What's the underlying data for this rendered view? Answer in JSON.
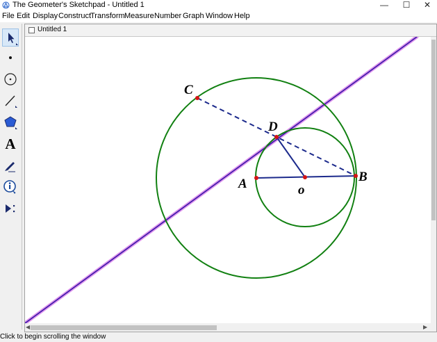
{
  "window": {
    "title": "The Geometer's Sketchpad - Untitled 1",
    "controls": {
      "minimize": "—",
      "maximize": "☐",
      "close": "✕"
    }
  },
  "menu": [
    "File",
    "Edit",
    "Display",
    "Construct",
    "Transform",
    "Measure",
    "Number",
    "Graph",
    "Window",
    "Help"
  ],
  "toolbox": {
    "tools": [
      "arrow-select-tool",
      "point-tool",
      "compass-tool",
      "straightedge-tool",
      "polygon-tool",
      "text-tool",
      "marker-tool",
      "information-tool",
      "custom-tools"
    ],
    "text_tool_glyph": "A"
  },
  "document": {
    "title": "Untitled 1"
  },
  "sketch": {
    "point_labels": {
      "A": "A",
      "B": "B",
      "C": "C",
      "D": "D",
      "O": "o"
    },
    "colors": {
      "circle": "#118011",
      "segment": "#1c2a8c",
      "dashed": "#1c2a8c",
      "line": "#3a1aa8",
      "line_highlight": "#d46ee8",
      "point": "#d41414"
    }
  },
  "status": {
    "text": "Click to begin scrolling the window"
  }
}
